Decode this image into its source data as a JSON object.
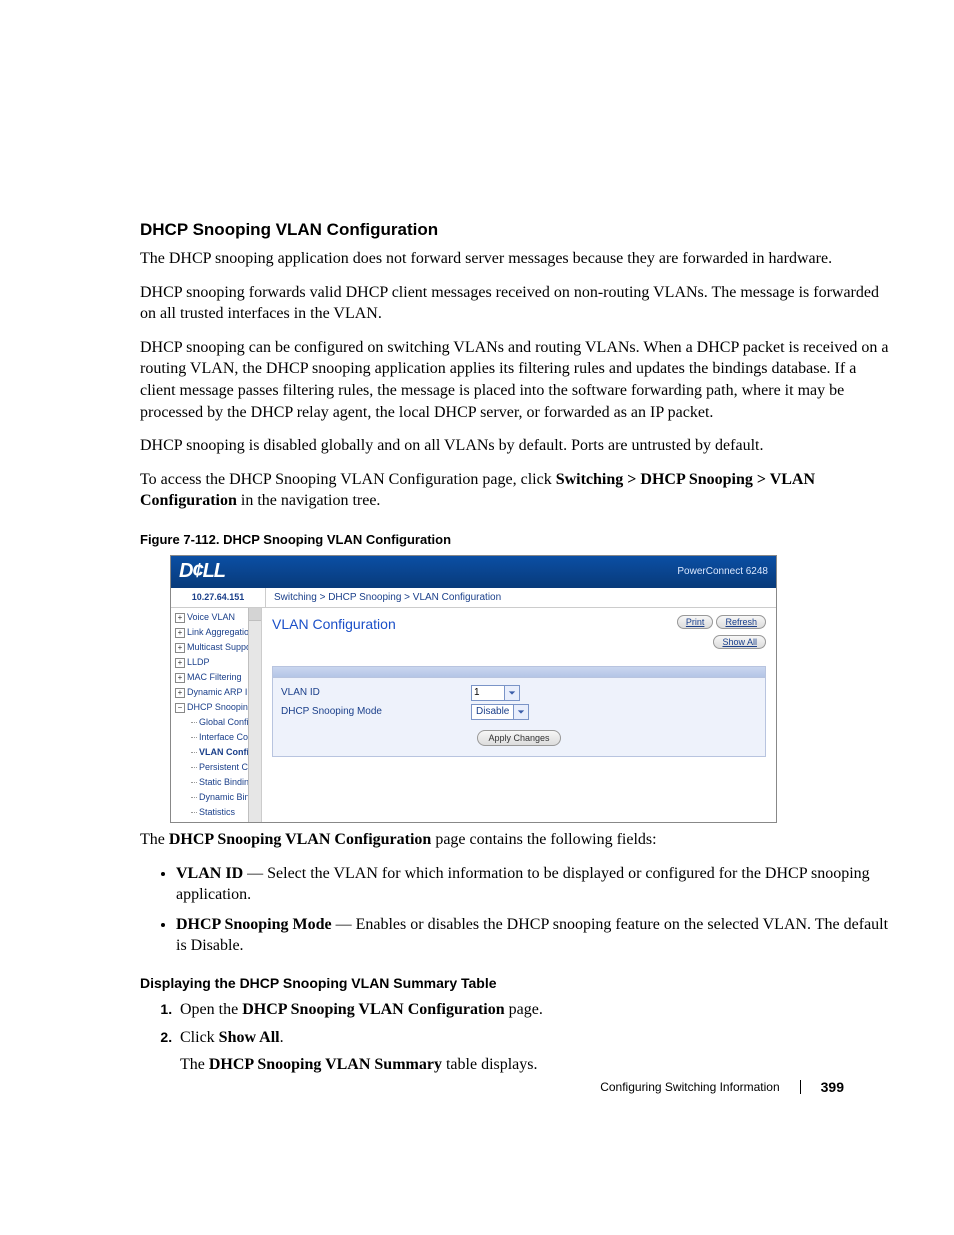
{
  "section_title": "DHCP Snooping VLAN Configuration",
  "para1": "The DHCP snooping application does not forward server messages because they are forwarded in hardware.",
  "para2": "DHCP snooping forwards valid DHCP client messages received on non-routing VLANs. The message is forwarded on all trusted interfaces in the VLAN.",
  "para3": "DHCP snooping can be configured on switching VLANs and routing VLANs. When a DHCP packet is received on a routing VLAN, the DHCP snooping application applies its filtering rules and updates the bindings database. If a client message passes filtering rules, the message is placed into the software forwarding path, where it may be processed by the DHCP relay agent, the local DHCP server, or forwarded as an IP packet.",
  "para4": "DHCP snooping is disabled globally and on all VLANs by default. Ports are untrusted by default.",
  "para5_pre": "To access the DHCP Snooping VLAN Configuration page, click ",
  "para5_bold": "Switching > DHCP Snooping > VLAN Configuration",
  "para5_post": " in the navigation tree.",
  "figure_caption": "Figure 7-112.    DHCP Snooping VLAN Configuration",
  "screenshot": {
    "logo": "D¢LL",
    "model": "PowerConnect 6248",
    "ip": "10.27.64.151",
    "breadcrumb": "Switching > DHCP Snooping > VLAN Configuration",
    "nav": {
      "items": [
        {
          "pm": "+",
          "label": "Voice VLAN"
        },
        {
          "pm": "+",
          "label": "Link Aggregation"
        },
        {
          "pm": "+",
          "label": "Multicast Support"
        },
        {
          "pm": "+",
          "label": "LLDP"
        },
        {
          "pm": "+",
          "label": "MAC Filtering"
        },
        {
          "pm": "+",
          "label": "Dynamic ARP Inspe"
        },
        {
          "pm": "−",
          "label": "DHCP Snooping"
        }
      ],
      "children": [
        {
          "label": "Global Configurat"
        },
        {
          "label": "Interface Configu"
        },
        {
          "label": "VLAN Configurat",
          "sel": true
        },
        {
          "label": "Persistent Config"
        },
        {
          "label": "Static Bindings C"
        },
        {
          "label": "Dynamic Binding"
        },
        {
          "label": "Statistics"
        }
      ]
    },
    "panel_title": "VLAN Configuration",
    "btn_print": "Print",
    "btn_refresh": "Refresh",
    "btn_showall": "Show All",
    "row1_label": "VLAN ID",
    "row1_value": "1",
    "row2_label": "DHCP Snooping Mode",
    "row2_value": "Disable",
    "btn_apply": "Apply Changes"
  },
  "after_pre": "The ",
  "after_bold": "DHCP Snooping VLAN Configuration",
  "after_post": " page contains the following fields:",
  "fields": [
    {
      "term": "VLAN ID",
      "desc": " — Select the VLAN for which information to be displayed or configured for the DHCP snooping application."
    },
    {
      "term": "DHCP Snooping Mode",
      "desc": " — Enables or disables the DHCP snooping feature on the selected VLAN. The default is Disable."
    }
  ],
  "subhead": "Displaying the DHCP Snooping VLAN Summary Table",
  "steps": {
    "s1_pre": "Open the ",
    "s1_bold": "DHCP Snooping VLAN Configuration",
    "s1_post": " page.",
    "s2_pre": "Click ",
    "s2_bold": "Show All",
    "s2_post": ".",
    "s2b_pre": "The ",
    "s2b_bold": "DHCP Snooping VLAN Summary",
    "s2b_post": " table displays."
  },
  "footer_text": "Configuring Switching Information",
  "page_number": "399"
}
